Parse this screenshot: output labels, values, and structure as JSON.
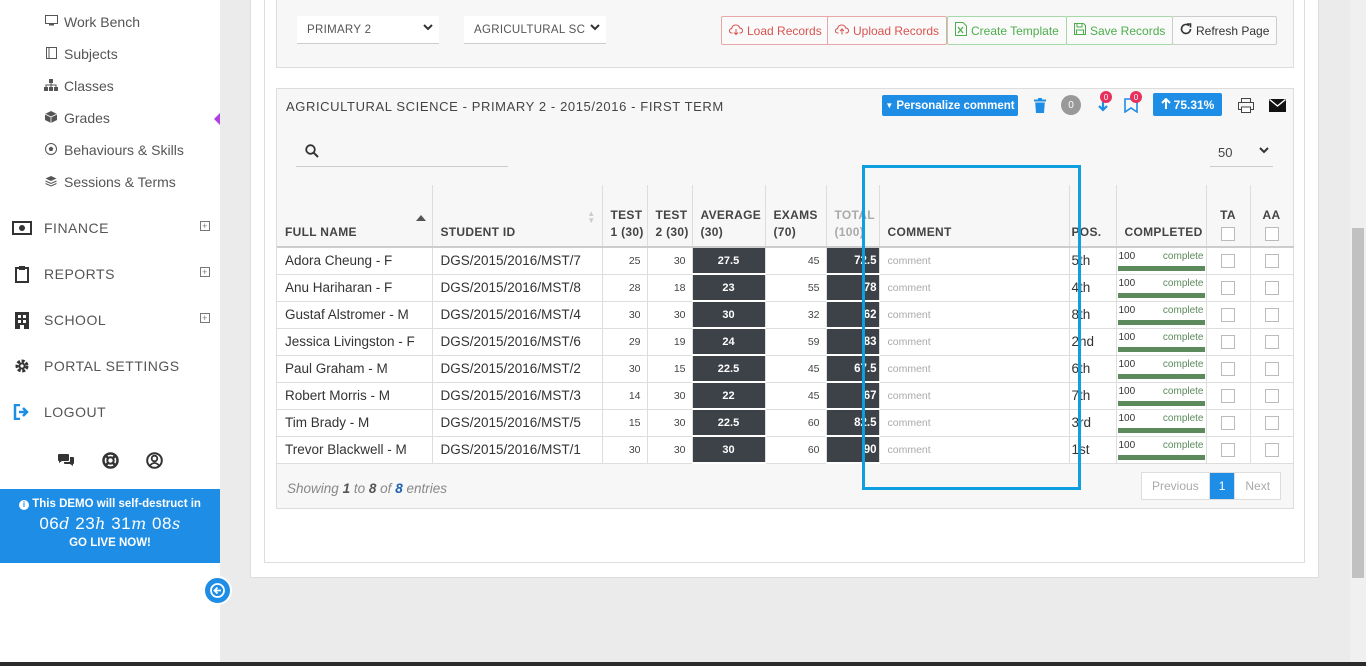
{
  "sidebar": {
    "sub_items": [
      {
        "label": "Work Bench",
        "icon": "monitor-icon"
      },
      {
        "label": "Subjects",
        "icon": "book-icon"
      },
      {
        "label": "Classes",
        "icon": "sitemap-icon"
      },
      {
        "label": "Grades",
        "icon": "cube-icon"
      },
      {
        "label": "Behaviours & Skills",
        "icon": "soccer-ball-icon"
      },
      {
        "label": "Sessions & Terms",
        "icon": "layers-icon"
      }
    ],
    "main_items": [
      {
        "label": "FINANCE",
        "icon": "money-icon"
      },
      {
        "label": "REPORTS",
        "icon": "clipboard-icon"
      },
      {
        "label": "SCHOOL",
        "icon": "building-icon"
      },
      {
        "label": "PORTAL SETTINGS",
        "icon": "gear-icon"
      },
      {
        "label": "LOGOUT",
        "icon": "sign-out-icon"
      }
    ],
    "demo": {
      "line1": "This DEMO will self-destruct in",
      "d": "06",
      "d_unit": "d",
      "h": "23",
      "h_unit": "h",
      "m": "31",
      "m_unit": "m",
      "s": "08",
      "s_unit": "s",
      "cta": "GO LIVE NOW!"
    }
  },
  "toolbar": {
    "class_select": "PRIMARY 2",
    "subject_select": "AGRICULTURAL SC",
    "load_records": "Load Records",
    "upload_records": "Upload Records",
    "create_template": "Create Template",
    "save_records": "Save Records",
    "refresh_page": "Refresh Page"
  },
  "panel": {
    "title": "AGRICULTURAL SCIENCE - PRIMARY 2 - 2015/2016 - FIRST TERM",
    "personalize": "Personalize comment",
    "zero_count": "0",
    "download_badge": "0",
    "bookmark_badge": "0",
    "percent": "75.31%",
    "page_size": "50"
  },
  "table": {
    "headers": {
      "full_name": "FULL NAME",
      "student_id": "STUDENT ID",
      "test1": "TEST 1 (30)",
      "test2": "TEST 2 (30)",
      "average": "AVERAGE (30)",
      "exams": "EXAMS (70)",
      "total": "TOTAL (100)",
      "comment": "COMMENT",
      "pos": "POS.",
      "completed": "COMPLETED",
      "ta": "TA",
      "aa": "AA"
    },
    "comment_placeholder": "comment",
    "rows": [
      {
        "name": "Adora  Cheung - F",
        "id": "DGS/2015/2016/MST/7",
        "t1": "25",
        "t2": "30",
        "avg": "27.5",
        "exam": "45",
        "total": "72.5",
        "pos": "5th",
        "done": "100",
        "status": "complete"
      },
      {
        "name": "Anu  Hariharan - F",
        "id": "DGS/2015/2016/MST/8",
        "t1": "28",
        "t2": "18",
        "avg": "23",
        "exam": "55",
        "total": "78",
        "pos": "4th",
        "done": "100",
        "status": "complete"
      },
      {
        "name": "Gustaf  Alstromer - M",
        "id": "DGS/2015/2016/MST/4",
        "t1": "30",
        "t2": "30",
        "avg": "30",
        "exam": "32",
        "total": "62",
        "pos": "8th",
        "done": "100",
        "status": "complete"
      },
      {
        "name": "Jessica  Livingston - F",
        "id": "DGS/2015/2016/MST/6",
        "t1": "29",
        "t2": "19",
        "avg": "24",
        "exam": "59",
        "total": "83",
        "pos": "2nd",
        "done": "100",
        "status": "complete"
      },
      {
        "name": "Paul  Graham - M",
        "id": "DGS/2015/2016/MST/2",
        "t1": "30",
        "t2": "15",
        "avg": "22.5",
        "exam": "45",
        "total": "67.5",
        "pos": "6th",
        "done": "100",
        "status": "complete"
      },
      {
        "name": "Robert  Morris - M",
        "id": "DGS/2015/2016/MST/3",
        "t1": "14",
        "t2": "30",
        "avg": "22",
        "exam": "45",
        "total": "67",
        "pos": "7th",
        "done": "100",
        "status": "complete"
      },
      {
        "name": "Tim  Brady - M",
        "id": "DGS/2015/2016/MST/5",
        "t1": "15",
        "t2": "30",
        "avg": "22.5",
        "exam": "60",
        "total": "82.5",
        "pos": "3rd",
        "done": "100",
        "status": "complete"
      },
      {
        "name": "Trevor  Blackwell - M",
        "id": "DGS/2015/2016/MST/1",
        "t1": "30",
        "t2": "30",
        "avg": "30",
        "exam": "60",
        "total": "90",
        "pos": "1st",
        "done": "100",
        "status": "complete"
      }
    ]
  },
  "footer": {
    "showing_prefix": "Showing",
    "from": "1",
    "to_word": "to",
    "to": "8",
    "of_word": "of",
    "total": "8",
    "entries_word": "entries",
    "previous": "Previous",
    "page": "1",
    "next": "Next"
  },
  "colors": {
    "accent": "#1e8de6",
    "highlight": "#0e9fe0",
    "dark_cell": "#3d4248",
    "progress": "#5c8a5c"
  }
}
